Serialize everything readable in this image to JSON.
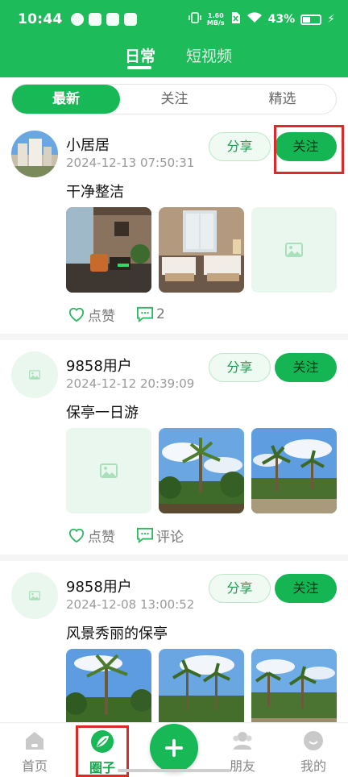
{
  "status_bar": {
    "time": "10:44",
    "network_speed_value": "1.60",
    "network_speed_unit": "MB/s",
    "battery": "43%",
    "icons": [
      "leaf-app-icon",
      "calendar-app-icon",
      "face-app-icon",
      "chat-app-icon",
      "vibrate-icon",
      "sim-off-icon",
      "wifi-icon",
      "battery-icon",
      "charging-icon"
    ]
  },
  "top_tabs": [
    {
      "label": "日常",
      "active": true
    },
    {
      "label": "短视频",
      "active": false
    }
  ],
  "filter_tabs": [
    {
      "label": "最新",
      "active": true
    },
    {
      "label": "关注",
      "active": false
    },
    {
      "label": "精选",
      "active": false
    }
  ],
  "posts": [
    {
      "username": "小居居",
      "timestamp": "2024-12-13 07:50:31",
      "text": "干净整洁",
      "share_label": "分享",
      "follow_label": "关注",
      "like_label": "点赞",
      "comment_label": "2",
      "photos": [
        "hotel-living-room-photo",
        "hotel-bedroom-photo",
        "image-placeholder"
      ]
    },
    {
      "username": "9858用户",
      "timestamp": "2024-12-12 20:39:09",
      "text": "保亭一日游",
      "share_label": "分享",
      "follow_label": "关注",
      "like_label": "点赞",
      "comment_label": "评论",
      "photos": [
        "image-placeholder",
        "palm-garden-photo",
        "palm-garden-photo"
      ]
    },
    {
      "username": "9858用户",
      "timestamp": "2024-12-08 13:00:52",
      "text": "风景秀丽的保亭",
      "share_label": "分享",
      "follow_label": "关注",
      "like_label": "点赞",
      "comment_label": "评论",
      "photos": [
        "palm-garden-photo",
        "palm-garden-photo",
        "palm-garden-photo"
      ]
    }
  ],
  "bottom_nav": [
    {
      "label": "首页",
      "icon": "home-icon",
      "active": false
    },
    {
      "label": "圈子",
      "icon": "circle-leaf-icon",
      "active": true
    },
    {
      "label": "",
      "icon": "plus-icon",
      "active": false
    },
    {
      "label": "朋友",
      "icon": "friends-icon",
      "active": false
    },
    {
      "label": "我的",
      "icon": "profile-icon",
      "active": false
    }
  ],
  "colors": {
    "brand_green": "#1dbb5a",
    "highlight_red": "#d92b2b",
    "placeholder_green": "#e9f7ee"
  }
}
